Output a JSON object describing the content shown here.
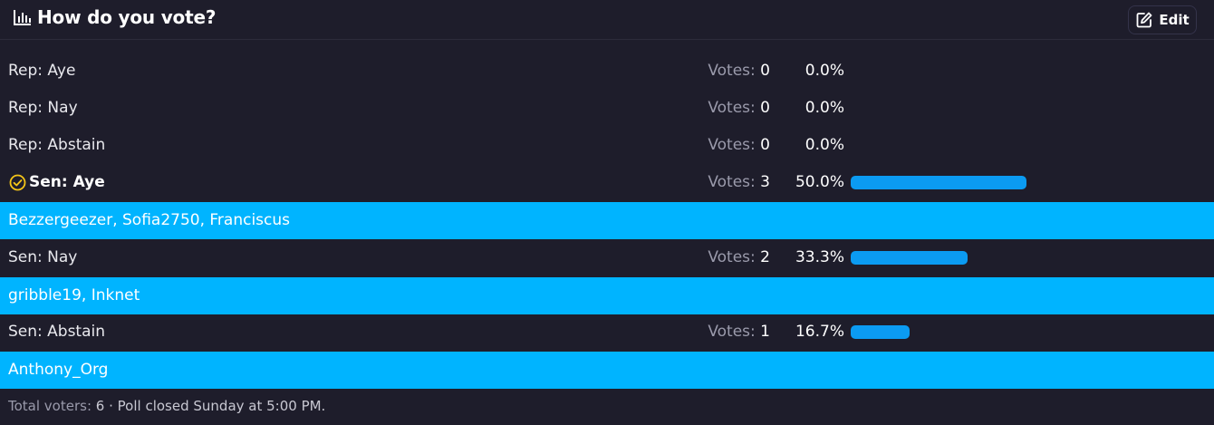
{
  "header": {
    "title": "How do you vote?",
    "title_icon": "poll-chart-icon",
    "edit_label": "Edit",
    "edit_icon": "edit-icon"
  },
  "options": [
    {
      "label": "Rep: Aye",
      "votes_label": "Votes:",
      "votes": "0",
      "percent_text": "0.0%",
      "fraction": 0.0
    },
    {
      "label": "Rep: Nay",
      "votes_label": "Votes:",
      "votes": "0",
      "percent_text": "0.0%",
      "fraction": 0.0
    },
    {
      "label": "Rep: Abstain",
      "votes_label": "Votes:",
      "votes": "0",
      "percent_text": "0.0%",
      "fraction": 0.0
    },
    {
      "label": "Sen: Aye",
      "votes_label": "Votes:",
      "votes": "3",
      "percent_text": "50.0%",
      "fraction": 0.5,
      "selected": true,
      "voters": "Bezzergeezer, Sofia2750, Franciscus"
    },
    {
      "label": "Sen: Nay",
      "votes_label": "Votes:",
      "votes": "2",
      "percent_text": "33.3%",
      "fraction": 0.333,
      "voters": "gribble19, Inknet"
    },
    {
      "label": "Sen: Abstain",
      "votes_label": "Votes:",
      "votes": "1",
      "percent_text": "16.7%",
      "fraction": 0.167,
      "voters": "Anthony_Org"
    }
  ],
  "footer": {
    "total_label": "Total voters:",
    "total": "6",
    "separator": "·",
    "status": "Poll closed Sunday at 5:00 PM."
  },
  "colors": {
    "background": "#1e1d2b",
    "bar": "#0b9bf2",
    "voters_highlight": "#00b4ff",
    "selected_check": "#f5c518"
  }
}
